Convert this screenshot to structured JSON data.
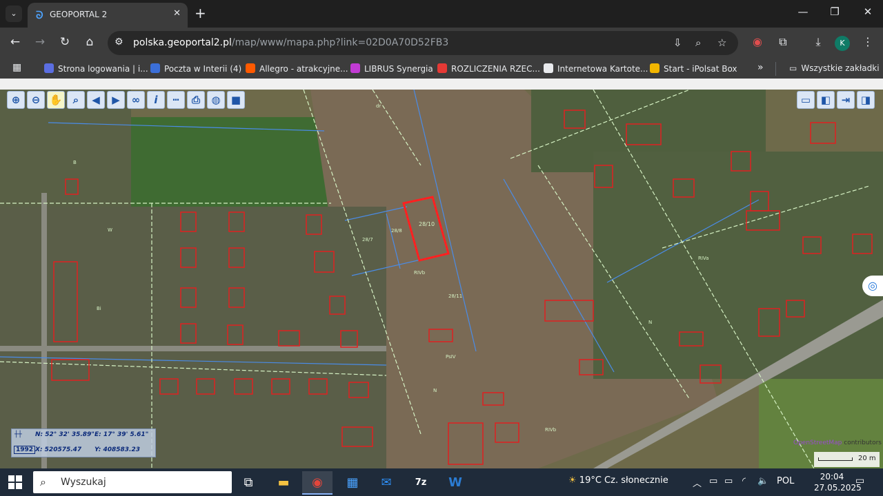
{
  "browser": {
    "tab_title": "GEOPORTAL 2",
    "tab_favicon": "geoportal-icon",
    "url_host": "polska.geoportal2.pl",
    "url_path": "/map/www/mapa.php?link=02D0A70D52FB3",
    "profile_initial": "K"
  },
  "bookmarks": [
    {
      "label": "Strona logowania | i...",
      "icon_color": "#5b6ee1"
    },
    {
      "label": "Poczta w Interii (4)",
      "icon_color": "#3b6fd8"
    },
    {
      "label": "Allegro - atrakcyjne...",
      "icon_color": "#ff5a00"
    },
    {
      "label": "LIBRUS Synergia",
      "icon_color": "#c23bd4"
    },
    {
      "label": "ROZLICZENIA RZEC...",
      "icon_color": "#e53935"
    },
    {
      "label": "Internetowa Kartote...",
      "icon_color": "#e8eaed"
    },
    {
      "label": "Start - iPolsat Box",
      "icon_color": "#f2b600"
    }
  ],
  "bookmarks_more": "»",
  "all_bookmarks": "Wszystkie zakładki",
  "map": {
    "selected_parcel": "28/10",
    "parcel_labels": [
      "28/10",
      "28/7",
      "28/11",
      "28/8",
      "RIVb",
      "N",
      "PsIV",
      "Bi",
      "B",
      "W",
      "dr",
      "N",
      "RIVa",
      "RIVb"
    ],
    "coords": {
      "n": "N: 52° 32' 35.89\"",
      "e": "E: 17° 39' 5.61\"",
      "x": "X: 520575.47",
      "y": "Y: 408583.23",
      "crs": "1992"
    },
    "scale": "20 m",
    "attribution_link": "OpenStreetMap",
    "attribution_text": " contributors"
  },
  "taskbar": {
    "search_placeholder": "Wyszukaj",
    "weather": "19°C  Cz. słonecznie",
    "language": "POL",
    "time": "20:04",
    "date": "27.05.2025"
  }
}
